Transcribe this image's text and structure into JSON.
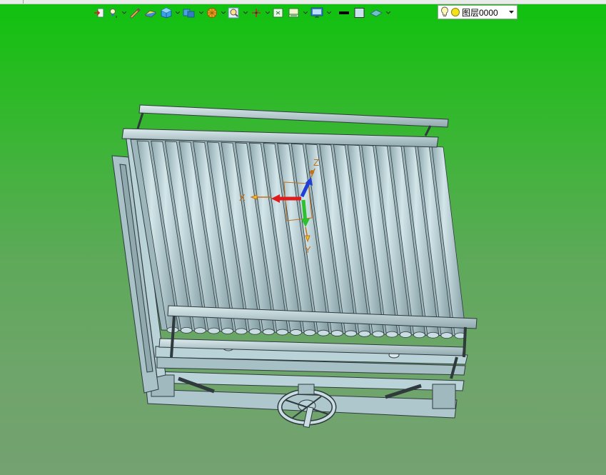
{
  "toolbar": {
    "tools": [
      {
        "icon": "import-icon",
        "has_dropdown": false
      },
      {
        "icon": "light-bulb-icon",
        "has_dropdown": true
      },
      {
        "icon": "sketch-icon",
        "has_dropdown": false
      },
      {
        "icon": "eraser-icon",
        "has_dropdown": false
      },
      {
        "icon": "solid-cube-icon",
        "has_dropdown": true
      },
      {
        "icon": "boolean-cubes-icon",
        "has_dropdown": true
      },
      {
        "icon": "render-sphere-icon",
        "has_dropdown": true
      },
      {
        "icon": "zoom-icon",
        "has_dropdown": true
      },
      {
        "icon": "move-axis-icon",
        "has_dropdown": true
      },
      {
        "icon": "fit-view-icon",
        "has_dropdown": false
      },
      {
        "icon": "section-view-icon",
        "has_dropdown": true
      },
      {
        "icon": "display-monitor-icon",
        "has_dropdown": true
      },
      {
        "icon": "line-color-icon",
        "has_dropdown": false
      },
      {
        "icon": "fill-color-icon",
        "has_dropdown": false
      },
      {
        "icon": "layer-plane-icon",
        "has_dropdown": true
      }
    ],
    "layer_select": {
      "value": "图层0000",
      "icons": [
        "bulb-icon",
        "yellow-circle-icon"
      ]
    }
  },
  "triad": {
    "x_label": "X",
    "y_label": "Y",
    "z_label": "Z"
  },
  "colors": {
    "background_top": "#0ec20e",
    "background_bottom": "#74a271",
    "model_fill": "#b9d3d9",
    "model_edge": "#2f3a3d",
    "axis_x": "#e01b1b",
    "axis_y": "#2fbf2f",
    "axis_z": "#1f3fd6",
    "axis_label": "#c0711f"
  }
}
